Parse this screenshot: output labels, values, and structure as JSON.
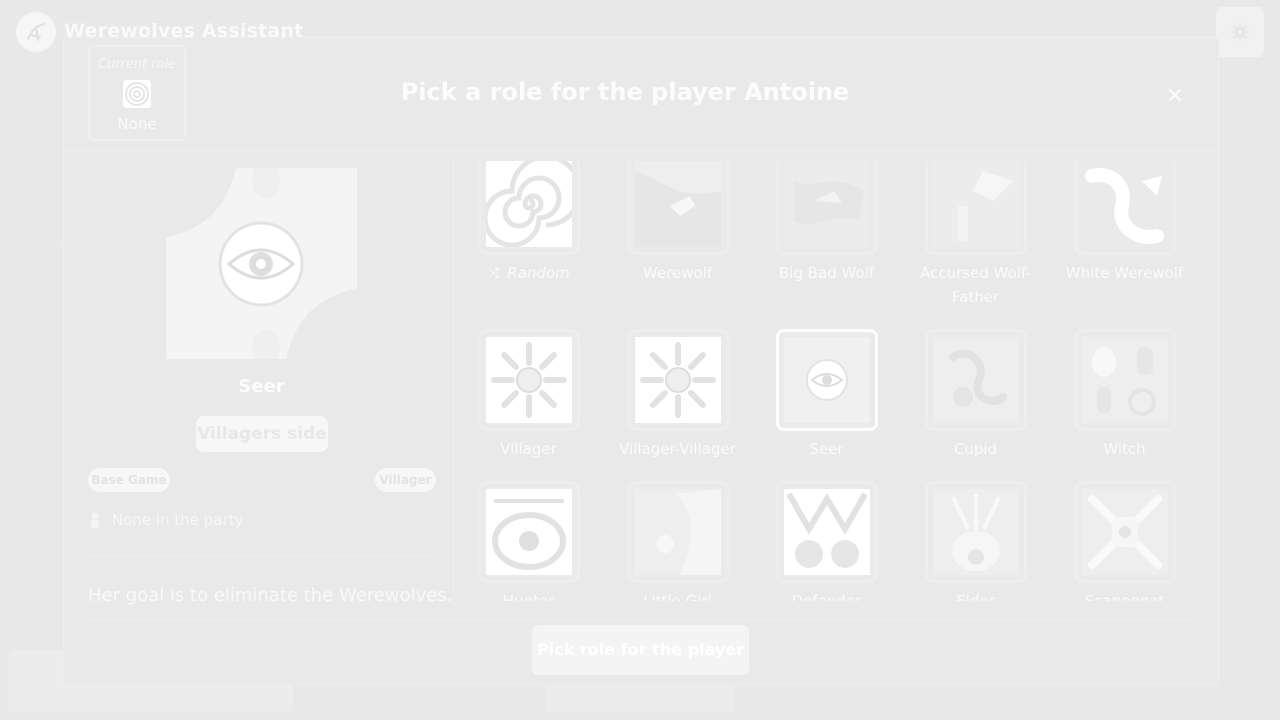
{
  "app": {
    "title": "Werewolves Assistant"
  },
  "modal": {
    "title": "Pick a role for the player Antoine",
    "current_role_label": "Current role",
    "current_role_value": "None",
    "confirm_button": "Pick role for the player"
  },
  "detail": {
    "name": "Seer",
    "side": "Villagers side",
    "tags": [
      "Base Game",
      "Villager"
    ],
    "party": "None in the party",
    "description": "Her goal is to eliminate the Werewolves."
  },
  "roles": [
    {
      "label": "Random",
      "icon": "shuffle-icon"
    },
    {
      "label": "Werewolf"
    },
    {
      "label": "Big Bad Wolf"
    },
    {
      "label": "Accursed Wolf-Father"
    },
    {
      "label": "White Werewolf"
    },
    {
      "label": "Villager"
    },
    {
      "label": "Villager-Villager"
    },
    {
      "label": "Seer",
      "selected": true
    },
    {
      "label": "Cupid"
    },
    {
      "label": "Witch"
    },
    {
      "label": "Hunter"
    },
    {
      "label": "Little Girl"
    },
    {
      "label": "Defender"
    },
    {
      "label": "Elder"
    },
    {
      "label": "Scapegoat"
    }
  ]
}
